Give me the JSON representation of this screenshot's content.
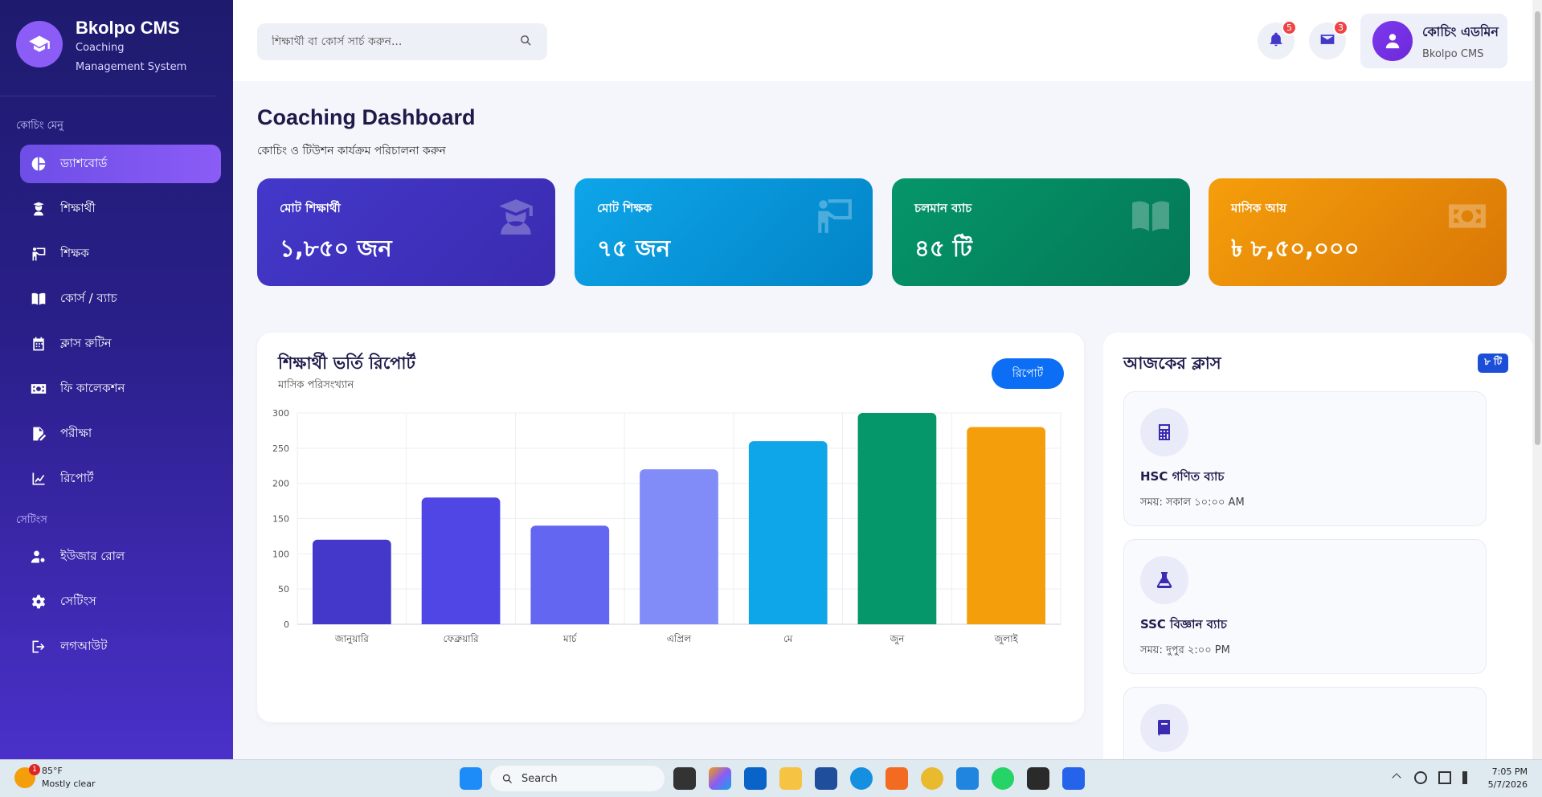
{
  "brand": {
    "title": "Bkolpo CMS",
    "subtitle": "Coaching Management System"
  },
  "sidebar": {
    "section1": "কোচিং মেনু",
    "section2": "সেটিংস",
    "items": [
      {
        "label": "ড্যাশবোর্ড",
        "icon": "pie-chart-icon",
        "active": true
      },
      {
        "label": "শিক্ষার্থী",
        "icon": "student-icon"
      },
      {
        "label": "শিক্ষক",
        "icon": "teacher-icon"
      },
      {
        "label": "কোর্স / ব্যাচ",
        "icon": "book-icon"
      },
      {
        "label": "ক্লাস রুটিন",
        "icon": "calendar-icon"
      },
      {
        "label": "ফি কালেকশন",
        "icon": "money-icon"
      },
      {
        "label": "পরীক্ষা",
        "icon": "exam-icon"
      },
      {
        "label": "রিপোর্ট",
        "icon": "line-chart-icon"
      }
    ],
    "settings_items": [
      {
        "label": "ইউজার রোল",
        "icon": "user-gear-icon"
      },
      {
        "label": "সেটিংস",
        "icon": "gear-icon"
      },
      {
        "label": "লগআউট",
        "icon": "logout-icon"
      }
    ]
  },
  "header": {
    "search_placeholder": "শিক্ষার্থী বা কোর্স সার্চ করুন...",
    "notifications": "5",
    "messages": "3",
    "profile_name": "কোচিং এডমিন",
    "profile_role": "Bkolpo CMS"
  },
  "page": {
    "title": "Coaching Dashboard",
    "subtitle": "কোচিং ও টিউশন কার্যক্রম পরিচালনা করুন"
  },
  "stats": [
    {
      "label": "মোট শিক্ষার্থী",
      "value": "১,৮৫০ জন",
      "color": "#4338ca"
    },
    {
      "label": "মোট শিক্ষক",
      "value": "৭৫ জন",
      "color": "#0ea5e9"
    },
    {
      "label": "চলমান ব্যাচ",
      "value": "৪৫ টি",
      "color": "#059669"
    },
    {
      "label": "মাসিক আয়",
      "value": "৳ ৮,৫০,০০০",
      "color": "#f59e0b"
    }
  ],
  "chart": {
    "title": "শিক্ষার্থী ভর্তি রিপোর্ট",
    "subtitle": "মাসিক পরিসংখ্যান",
    "button": "রিপোর্ট"
  },
  "chart_data": {
    "type": "bar",
    "categories": [
      "জানুয়ারি",
      "ফেব্রুয়ারি",
      "মার্চ",
      "এপ্রিল",
      "মে",
      "জুন",
      "জুলাই"
    ],
    "values": [
      120,
      180,
      140,
      220,
      260,
      300,
      280
    ],
    "colors": [
      "#4338ca",
      "#4f46e5",
      "#6366f1",
      "#818cf8",
      "#0ea5e9",
      "#059669",
      "#f59e0b"
    ],
    "ylim": [
      0,
      300
    ],
    "yticks": [
      "0",
      "50",
      "100",
      "150",
      "200",
      "250",
      "300"
    ],
    "title": "",
    "xlabel": "",
    "ylabel": "",
    "grid": true
  },
  "classes": {
    "title": "আজকের ক্লাস",
    "count": "৮ টি",
    "items": [
      {
        "name": "HSC গণিত ব্যাচ",
        "time": "সময়: সকাল ১০:০০ AM",
        "icon": "calculator-icon"
      },
      {
        "name": "SSC বিজ্ঞান ব্যাচ",
        "time": "সময়: দুপুর ২:০০ PM",
        "icon": "flask-icon"
      },
      {
        "name": "",
        "time": "",
        "icon": "book-icon"
      }
    ]
  },
  "taskbar": {
    "temp": "85°F",
    "weather": "Mostly clear",
    "weather_badge": "1",
    "search": "Search",
    "time": "7:05 PM",
    "date": "5/7/2026"
  }
}
